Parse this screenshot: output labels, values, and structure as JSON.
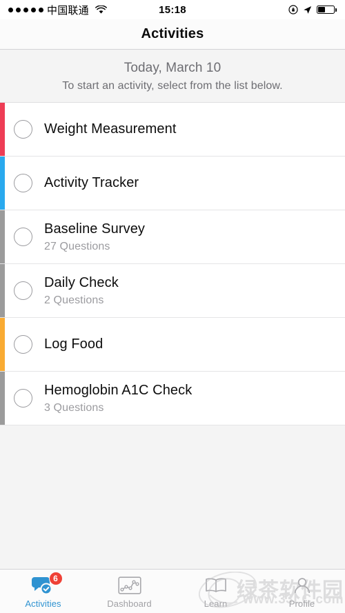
{
  "statusbar": {
    "signal_dots": 5,
    "carrier": "中国联通",
    "wifi_icon": "wifi-icon",
    "time": "15:18",
    "rotation_lock_icon": "rotation-lock-icon",
    "location_icon": "location-arrow-icon",
    "battery_icon": "battery-icon",
    "battery_level_percent": 45
  },
  "navbar": {
    "title": "Activities"
  },
  "header": {
    "date": "Today, March 10",
    "hint": "To start an activity, select from the list below."
  },
  "colors": {
    "accent": "#2f93d1",
    "badge": "#ef4136",
    "bar_red": "#ee3d55",
    "bar_blue": "#2aa9ee",
    "bar_gray": "#9b9b9b",
    "bar_orange": "#f9ab33",
    "title_text": "#0d0d0d",
    "subtitle_text": "#9b9b9f",
    "header_text": "#6d6d72"
  },
  "activities": [
    {
      "title": "Weight Measurement",
      "subtitle": "",
      "bar_color": "#ee3d55",
      "radio_icon": "radio-unchecked-icon"
    },
    {
      "title": "Activity Tracker",
      "subtitle": "",
      "bar_color": "#2aa9ee",
      "radio_icon": "radio-unchecked-icon"
    },
    {
      "title": "Baseline Survey",
      "subtitle": "27 Questions",
      "bar_color": "#9b9b9b",
      "radio_icon": "radio-unchecked-icon"
    },
    {
      "title": "Daily Check",
      "subtitle": "2 Questions",
      "bar_color": "#9b9b9b",
      "radio_icon": "radio-unchecked-icon"
    },
    {
      "title": "Log Food",
      "subtitle": "",
      "bar_color": "#f9ab33",
      "radio_icon": "radio-unchecked-icon"
    },
    {
      "title": "Hemoglobin A1C Check",
      "subtitle": "3 Questions",
      "bar_color": "#9b9b9b",
      "radio_icon": "radio-unchecked-icon"
    }
  ],
  "tabbar": [
    {
      "label": "Activities",
      "icon": "chat-bubbles-check-icon",
      "active": true,
      "badge": "6"
    },
    {
      "label": "Dashboard",
      "icon": "line-chart-icon",
      "active": false,
      "badge": ""
    },
    {
      "label": "Learn",
      "icon": "open-book-icon",
      "active": false,
      "badge": ""
    },
    {
      "label": "Profile",
      "icon": "person-icon",
      "active": false,
      "badge": ""
    }
  ],
  "watermark": {
    "text_cn": "绿茶软件园",
    "text_url": "www.33LC.com"
  }
}
